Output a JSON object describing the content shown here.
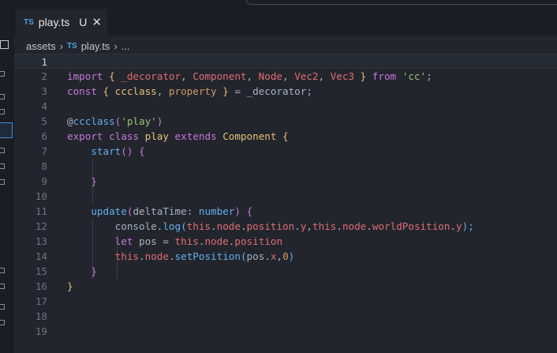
{
  "tab": {
    "lang_badge": "TS",
    "file_name": "play.ts",
    "modified_marker": "U",
    "close_glyph": "✕"
  },
  "breadcrumb": {
    "folder": "assets",
    "lang_badge": "TS",
    "file_name": "play.ts",
    "more": "..."
  },
  "icons": {
    "close": "close-icon",
    "chevron": "chevron-right-icon",
    "typescript": "ts-file-icon"
  },
  "colors": {
    "background": "#22252c",
    "keyword": "#c678dd",
    "class": "#e5c07b",
    "function": "#61afef",
    "string": "#98c379",
    "property": "#e06c75",
    "number": "#d19a66"
  },
  "lines": [
    {
      "n": "1",
      "tokens": []
    },
    {
      "n": "2",
      "tokens": [
        {
          "t": "import",
          "c": "kw"
        },
        {
          "t": " { ",
          "c": "brace"
        },
        {
          "t": "_decorator",
          "c": "prop"
        },
        {
          "t": ", ",
          "c": "dim"
        },
        {
          "t": "Component",
          "c": "prop"
        },
        {
          "t": ", ",
          "c": "dim"
        },
        {
          "t": "Node",
          "c": "prop"
        },
        {
          "t": ", ",
          "c": "dim"
        },
        {
          "t": "Vec2",
          "c": "prop"
        },
        {
          "t": ", ",
          "c": "dim"
        },
        {
          "t": "Vec3",
          "c": "prop"
        },
        {
          "t": " } ",
          "c": "brace"
        },
        {
          "t": "from",
          "c": "kw"
        },
        {
          "t": " ",
          "c": "dim"
        },
        {
          "t": "'cc'",
          "c": "str"
        },
        {
          "t": ";",
          "c": "dim"
        }
      ]
    },
    {
      "n": "3",
      "tokens": [
        {
          "t": "const",
          "c": "kw"
        },
        {
          "t": " { ",
          "c": "brace"
        },
        {
          "t": "ccclass",
          "c": "cls"
        },
        {
          "t": ", ",
          "c": "dim"
        },
        {
          "t": "property",
          "c": "num"
        },
        {
          "t": " } ",
          "c": "brace"
        },
        {
          "t": "=",
          "c": "dim"
        },
        {
          "t": " _decorator;",
          "c": "dim"
        }
      ]
    },
    {
      "n": "4",
      "tokens": []
    },
    {
      "n": "5",
      "tokens": [
        {
          "t": "@",
          "c": "dim"
        },
        {
          "t": "ccclass",
          "c": "fn"
        },
        {
          "t": "(",
          "c": "paren"
        },
        {
          "t": "'play'",
          "c": "str"
        },
        {
          "t": ")",
          "c": "paren"
        }
      ]
    },
    {
      "n": "6",
      "tokens": [
        {
          "t": "export",
          "c": "kw"
        },
        {
          "t": " ",
          "c": "dim"
        },
        {
          "t": "class",
          "c": "kw"
        },
        {
          "t": " ",
          "c": "dim"
        },
        {
          "t": "play",
          "c": "cls"
        },
        {
          "t": " ",
          "c": "dim"
        },
        {
          "t": "extends",
          "c": "kw"
        },
        {
          "t": " ",
          "c": "dim"
        },
        {
          "t": "Component",
          "c": "cls"
        },
        {
          "t": " {",
          "c": "brace"
        }
      ]
    },
    {
      "n": "7",
      "tokens": [
        {
          "t": "    ",
          "c": "dim"
        },
        {
          "t": "start",
          "c": "fn"
        },
        {
          "t": "() {",
          "c": "paren"
        }
      ]
    },
    {
      "n": "8",
      "tokens": []
    },
    {
      "n": "9",
      "tokens": [
        {
          "t": "    }",
          "c": "paren"
        }
      ]
    },
    {
      "n": "10",
      "tokens": []
    },
    {
      "n": "11",
      "tokens": [
        {
          "t": "    ",
          "c": "dim"
        },
        {
          "t": "update",
          "c": "fn"
        },
        {
          "t": "(",
          "c": "paren"
        },
        {
          "t": "deltaTime",
          "c": "dim"
        },
        {
          "t": ": ",
          "c": "dim"
        },
        {
          "t": "number",
          "c": "fn"
        },
        {
          "t": ") {",
          "c": "paren"
        }
      ]
    },
    {
      "n": "12",
      "tokens": [
        {
          "t": "        console.",
          "c": "dim"
        },
        {
          "t": "log",
          "c": "fn"
        },
        {
          "t": "(",
          "c": "fn"
        },
        {
          "t": "this",
          "c": "prop"
        },
        {
          "t": ".",
          "c": "dim"
        },
        {
          "t": "node",
          "c": "prop"
        },
        {
          "t": ".",
          "c": "dim"
        },
        {
          "t": "position",
          "c": "prop"
        },
        {
          "t": ".",
          "c": "dim"
        },
        {
          "t": "y",
          "c": "prop"
        },
        {
          "t": ",",
          "c": "dim"
        },
        {
          "t": "this",
          "c": "prop"
        },
        {
          "t": ".",
          "c": "dim"
        },
        {
          "t": "node",
          "c": "prop"
        },
        {
          "t": ".",
          "c": "dim"
        },
        {
          "t": "worldPosition",
          "c": "prop"
        },
        {
          "t": ".",
          "c": "dim"
        },
        {
          "t": "y",
          "c": "prop"
        },
        {
          "t": ");",
          "c": "fn"
        }
      ]
    },
    {
      "n": "13",
      "tokens": [
        {
          "t": "        ",
          "c": "dim"
        },
        {
          "t": "let",
          "c": "kw"
        },
        {
          "t": " pos = ",
          "c": "dim"
        },
        {
          "t": "this",
          "c": "prop"
        },
        {
          "t": ".",
          "c": "dim"
        },
        {
          "t": "node",
          "c": "prop"
        },
        {
          "t": ".",
          "c": "dim"
        },
        {
          "t": "position",
          "c": "prop"
        }
      ]
    },
    {
      "n": "14",
      "tokens": [
        {
          "t": "        ",
          "c": "dim"
        },
        {
          "t": "this",
          "c": "prop"
        },
        {
          "t": ".",
          "c": "dim"
        },
        {
          "t": "node",
          "c": "prop"
        },
        {
          "t": ".",
          "c": "dim"
        },
        {
          "t": "setPosition",
          "c": "fn"
        },
        {
          "t": "(",
          "c": "fn"
        },
        {
          "t": "pos.",
          "c": "dim"
        },
        {
          "t": "x",
          "c": "prop"
        },
        {
          "t": ",",
          "c": "dim"
        },
        {
          "t": "0",
          "c": "num"
        },
        {
          "t": ")",
          "c": "fn"
        }
      ]
    },
    {
      "n": "15",
      "tokens": [
        {
          "t": "    }",
          "c": "paren"
        }
      ]
    },
    {
      "n": "16",
      "tokens": [
        {
          "t": "}",
          "c": "brace"
        }
      ]
    },
    {
      "n": "17",
      "tokens": []
    },
    {
      "n": "18",
      "tokens": []
    },
    {
      "n": "19",
      "tokens": []
    }
  ]
}
